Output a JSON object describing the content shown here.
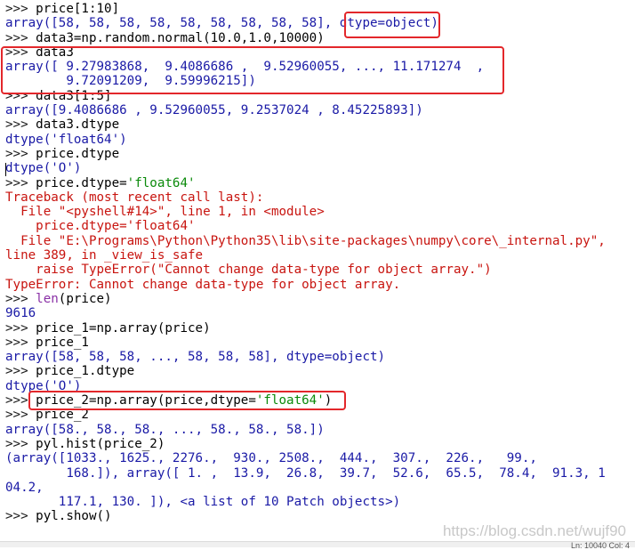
{
  "lines": [
    {
      "segs": [
        {
          "t": ">>> ",
          "c": "prompt"
        },
        {
          "t": "price[1:10]",
          "c": "in"
        }
      ]
    },
    {
      "segs": [
        {
          "t": "array([58, 58, 58, 58, 58, 58, 58, 58, 58], ",
          "c": "out"
        },
        {
          "t": "dtype=object",
          "c": "out"
        },
        {
          "t": ")",
          "c": "out"
        }
      ]
    },
    {
      "segs": [
        {
          "t": ">>> ",
          "c": "prompt"
        },
        {
          "t": "data3=np.random.normal(10.0,1.0,10000)",
          "c": "in"
        }
      ]
    },
    {
      "segs": [
        {
          "t": ">>> ",
          "c": "prompt"
        },
        {
          "t": "data3",
          "c": "in"
        }
      ]
    },
    {
      "segs": [
        {
          "t": "array([ 9.27983868,  9.4086686 ,  9.52960055, ..., 11.171274  ,",
          "c": "out"
        }
      ]
    },
    {
      "segs": [
        {
          "t": "        9.72091209,  9.59996215])",
          "c": "out"
        }
      ]
    },
    {
      "segs": [
        {
          "t": ">>> ",
          "c": "prompt"
        },
        {
          "t": "data3[1:5]",
          "c": "in"
        }
      ]
    },
    {
      "segs": [
        {
          "t": "array([9.4086686 , 9.52960055, 9.2537024 , 8.45225893])",
          "c": "out"
        }
      ]
    },
    {
      "segs": [
        {
          "t": ">>> ",
          "c": "prompt"
        },
        {
          "t": "data3.dtype",
          "c": "in"
        }
      ]
    },
    {
      "segs": [
        {
          "t": "dtype('float64')",
          "c": "out"
        }
      ]
    },
    {
      "segs": [
        {
          "t": ">>> ",
          "c": "prompt"
        },
        {
          "t": "price.dtype",
          "c": "in"
        }
      ]
    },
    {
      "segs": [
        {
          "t": "dtype('O')",
          "c": "out"
        }
      ]
    },
    {
      "segs": [
        {
          "t": ">>> ",
          "c": "prompt"
        },
        {
          "t": "price.dtype=",
          "c": "in"
        },
        {
          "t": "'float64'",
          "c": "str"
        }
      ]
    },
    {
      "segs": [
        {
          "t": "Traceback (most recent call last):",
          "c": "err"
        }
      ]
    },
    {
      "segs": [
        {
          "t": "  File \"<pyshell#14>\", line 1, in <module>",
          "c": "err"
        }
      ]
    },
    {
      "segs": [
        {
          "t": "    price.dtype='float64'",
          "c": "err"
        }
      ]
    },
    {
      "segs": [
        {
          "t": "  File \"E:\\Programs\\Python\\Python35\\lib\\site-packages\\numpy\\core\\_internal.py\",",
          "c": "err"
        }
      ]
    },
    {
      "segs": [
        {
          "t": "line 389, in _view_is_safe",
          "c": "err"
        }
      ]
    },
    {
      "segs": [
        {
          "t": "    raise TypeError(\"Cannot change data-type for object array.\")",
          "c": "err"
        }
      ]
    },
    {
      "segs": [
        {
          "t": "TypeError: Cannot change data-type for object array.",
          "c": "err"
        }
      ]
    },
    {
      "segs": [
        {
          "t": ">>> ",
          "c": "prompt"
        },
        {
          "t": "len",
          "c": "bi"
        },
        {
          "t": "(price)",
          "c": "in"
        }
      ]
    },
    {
      "segs": [
        {
          "t": "9616",
          "c": "out"
        }
      ]
    },
    {
      "segs": [
        {
          "t": ">>> ",
          "c": "prompt"
        },
        {
          "t": "price_1=np.array(price)",
          "c": "in"
        }
      ]
    },
    {
      "segs": [
        {
          "t": ">>> ",
          "c": "prompt"
        },
        {
          "t": "price_1",
          "c": "in"
        }
      ]
    },
    {
      "segs": [
        {
          "t": "array([58, 58, 58, ..., 58, 58, 58], dtype=object)",
          "c": "out"
        }
      ]
    },
    {
      "segs": [
        {
          "t": ">>> ",
          "c": "prompt"
        },
        {
          "t": "price_1.dtype",
          "c": "in"
        }
      ]
    },
    {
      "segs": [
        {
          "t": "dtype('O')",
          "c": "out"
        }
      ]
    },
    {
      "segs": [
        {
          "t": ">>> ",
          "c": "prompt"
        },
        {
          "t": "price_2=np.array(price,dtype=",
          "c": "in"
        },
        {
          "t": "'float64'",
          "c": "str"
        },
        {
          "t": ")",
          "c": "in"
        }
      ]
    },
    {
      "segs": [
        {
          "t": ">>> ",
          "c": "prompt"
        },
        {
          "t": "price_2",
          "c": "in"
        }
      ]
    },
    {
      "segs": [
        {
          "t": "array([58., 58., 58., ..., 58., 58., 58.])",
          "c": "out"
        }
      ]
    },
    {
      "segs": [
        {
          "t": ">>> ",
          "c": "prompt"
        },
        {
          "t": "pyl.hist(price_2)",
          "c": "in"
        }
      ]
    },
    {
      "segs": [
        {
          "t": "(array([1033., 1625., 2276.,  930., 2508.,  444.,  307.,  226.,   99.,",
          "c": "out"
        }
      ]
    },
    {
      "segs": [
        {
          "t": "        168.]), array([ 1. ,  13.9,  26.8,  39.7,  52.6,  65.5,  78.4,  91.3, 1",
          "c": "out"
        }
      ]
    },
    {
      "segs": [
        {
          "t": "04.2,",
          "c": "out"
        }
      ]
    },
    {
      "segs": [
        {
          "t": "       117.1, 130. ]), <a list of 10 Patch objects>)",
          "c": "out"
        }
      ]
    },
    {
      "segs": [
        {
          "t": ">>> ",
          "c": "prompt"
        },
        {
          "t": "pyl.show()",
          "c": "in"
        }
      ]
    }
  ],
  "watermark": "https://blog.csdn.net/wujf90",
  "status_text": "Ln: 10040  Col: 4",
  "colors": {
    "highlight": "#e3272b",
    "output": "#1a1aa6",
    "error": "#c8140f",
    "string": "#0a8a0a"
  }
}
